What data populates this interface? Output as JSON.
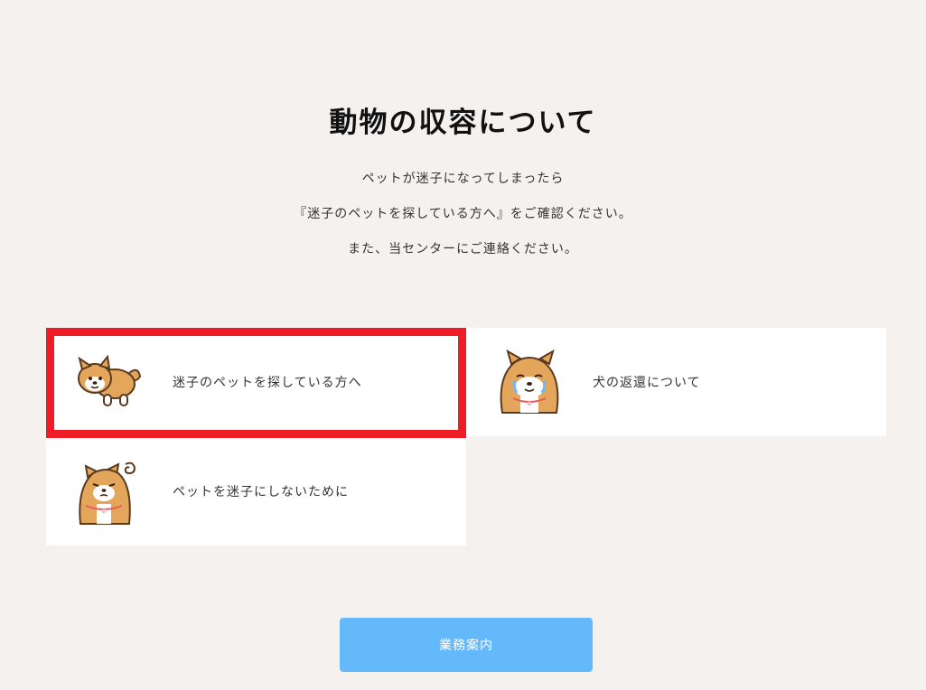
{
  "page": {
    "title": "動物の収容について",
    "intro_lines": [
      "ペットが迷子になってしまったら",
      "『迷子のペットを探している方へ』をご確認ください。",
      "また、当センターにご連絡ください。"
    ]
  },
  "cards": [
    {
      "label": "迷子のペットを探している方へ",
      "icon": "lying-dog-icon"
    },
    {
      "label": "犬の返還について",
      "icon": "crying-dog-icon"
    },
    {
      "label": "ペットを迷子にしないために",
      "icon": "worried-dog-icon"
    }
  ],
  "button": {
    "label": "業務案内"
  },
  "colors": {
    "background": "#f4f1ee",
    "card": "#ffffff",
    "highlight": "#ee1c25",
    "button": "#64b9fb",
    "dog_fur": "#e3a65a"
  }
}
